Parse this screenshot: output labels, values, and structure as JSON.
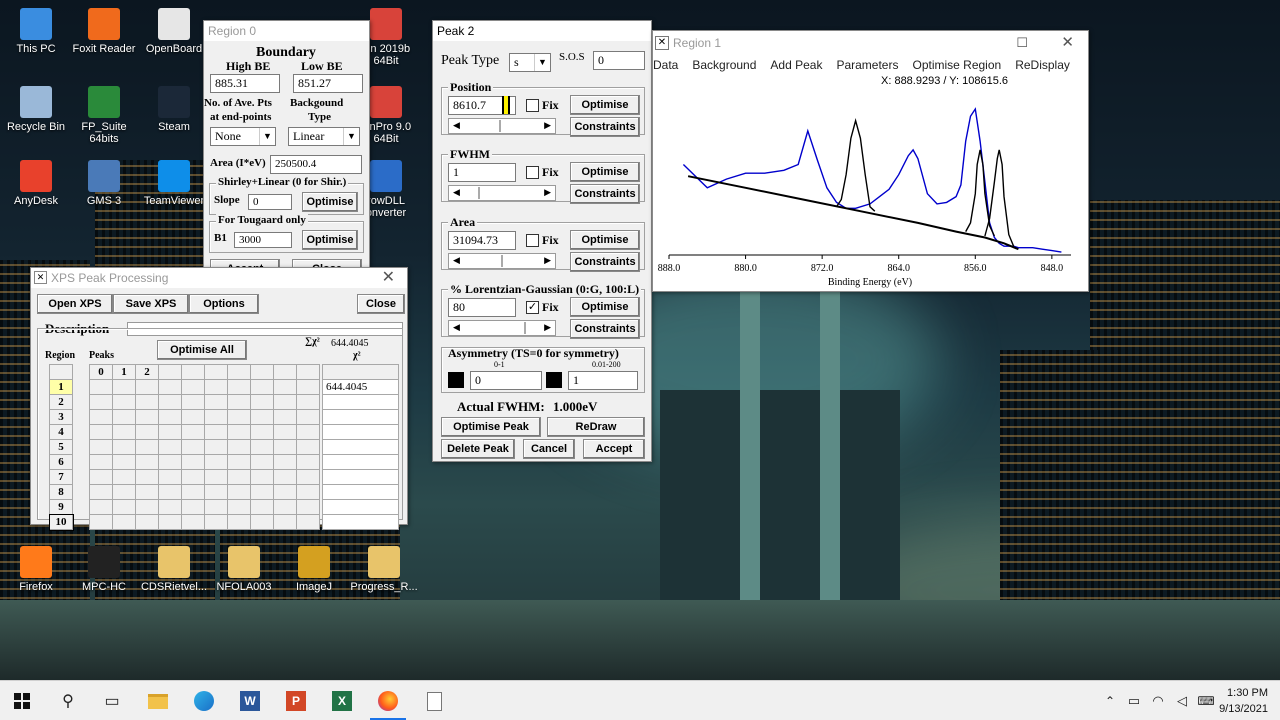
{
  "desktop_icons": [
    {
      "label": "This PC",
      "color": "#3a8de0"
    },
    {
      "label": "Foxit Reader",
      "color": "#f06a1c"
    },
    {
      "label": "OpenBoard",
      "color": "#e6e6e6"
    },
    {
      "label": "Recycle Bin",
      "color": "#9ab8d8"
    },
    {
      "label": "FP_Suite\n64bits",
      "color": "#2a8a3a"
    },
    {
      "label": "Steam",
      "color": "#1b2838"
    },
    {
      "label": "AnyDesk",
      "color": "#e8412c"
    },
    {
      "label": "GMS 3",
      "color": "#4a7ab8"
    },
    {
      "label": "TeamViewer",
      "color": "#0e8ee9"
    },
    {
      "label": "Firefox",
      "color": "#ff7a1a"
    },
    {
      "label": "MPC-HC",
      "color": "#222222"
    },
    {
      "label": "CDSRietvel...",
      "color": "#e8c46a"
    },
    {
      "label": "NFOLA003",
      "color": "#e8c46a"
    },
    {
      "label": "ImageJ",
      "color": "#d4a020"
    },
    {
      "label": "Progress_R...",
      "color": "#e8c46a"
    },
    {
      "label": "gin 2019b\n64Bit",
      "color": "#d8433a"
    },
    {
      "label": "ginPro 9.0\n64Bit",
      "color": "#d8433a"
    },
    {
      "label": "rowDLL\nonverter",
      "color": "#2b6cc8"
    }
  ],
  "region0": {
    "title": "Region 0",
    "heading": "Boundary",
    "high_be_label": "High BE",
    "low_be_label": "Low BE",
    "high_be": "885.31",
    "low_be": "851.27",
    "ave_pts_label_1": "No. of Ave. Pts",
    "ave_pts_label_2": "at end-points",
    "bg_type_label_1": "Backgound",
    "bg_type_label_2": "Type",
    "ave_pts_value": "None",
    "bg_type_value": "Linear",
    "area_label": "Area (I*eV)",
    "area_value": "250500.4",
    "shirley_title": "Shirley+Linear (0 for Shir.)",
    "slope_label": "Slope",
    "slope_value": "0",
    "tougaard_title": "For Tougaard only",
    "b1_label": "B1",
    "b1_value": "3000",
    "optimise_label": "Optimise",
    "accept_label": "Accept",
    "close_label": "Close"
  },
  "xps": {
    "title": "XPS Peak Processing",
    "open_label": "Open XPS",
    "save_label": "Save XPS",
    "options_label": "Options",
    "close_label": "Close",
    "description_label": "Description",
    "region_label": "Region",
    "peaks_label": "Peaks",
    "optimise_all_label": "Optimise All",
    "sum_chi_label": "∑χ²",
    "sum_chi_value": "644.4045",
    "chi_label": "χ²",
    "peak_cols": [
      "0",
      "1",
      "2",
      "",
      "",
      "",
      "",
      "",
      "",
      ""
    ],
    "regions": [
      "1",
      "2",
      "3",
      "4",
      "5",
      "6",
      "7",
      "8",
      "9",
      "10"
    ],
    "chi_values": [
      "644.4045",
      "",
      "",
      "",
      "",
      "",
      "",
      "",
      "",
      ""
    ]
  },
  "peak2": {
    "title": "Peak 2",
    "peak_type_label": "Peak Type",
    "peak_type_value": "s",
    "sos_label": "S.O.S",
    "sos_value": "0",
    "position_label": "Position",
    "position_value": "8610.7",
    "fwhm_label": "FWHM",
    "fwhm_value": "1",
    "area_label": "Area",
    "area_value": "31094.73",
    "lg_label": "% Lorentzian-Gaussian (0:G, 100:L)",
    "lg_value": "80",
    "fix_label": "Fix",
    "optimise_label": "Optimise",
    "constraints_label": "Constraints",
    "asym_label": "Asymmetry (TS=0 for symmetry)",
    "asym_range1": "0-1",
    "asym_range2": "0.01-200",
    "asym_value1": "0",
    "asym_value2": "1",
    "actual_fwhm_label": "Actual FWHM:",
    "actual_fwhm_value": "1.000eV",
    "optimise_peak_label": "Optimise Peak",
    "redraw_label": "ReDraw",
    "delete_label": "Delete Peak",
    "cancel_label": "Cancel",
    "accept_label": "Accept",
    "position_fixed": false,
    "fwhm_fixed": false,
    "area_fixed": false,
    "lg_fixed": true,
    "position_slider": 0.48,
    "fwhm_slider": 0.2,
    "area_slider": 0.5,
    "lg_slider": 0.8
  },
  "region1": {
    "title": "Region 1",
    "menu": [
      "Data",
      "Background",
      "Add Peak",
      "Parameters",
      "Optimise Region",
      "ReDisplay"
    ],
    "coord_readout": "X: 888.9293 / Y: 108615.6"
  },
  "chart_data": {
    "type": "line",
    "xlabel": "Binding Energy (eV)",
    "xlim": [
      888,
      846
    ],
    "x_ticks": [
      "888.0",
      "880.0",
      "872.0",
      "864.0",
      "856.0",
      "848.0"
    ],
    "tick_values": [
      888,
      880,
      872,
      864,
      856,
      848
    ],
    "grid": false,
    "series": [
      {
        "color": "#0000cc",
        "x": [
          886.5,
          884,
          882,
          880,
          878,
          876,
          874.5,
          873.5,
          872.5,
          871.5,
          870.5,
          869.5,
          868.5,
          867,
          866,
          865,
          864,
          863,
          862.5,
          862,
          861,
          860,
          859,
          858,
          857.5,
          857,
          856.5,
          856,
          855.5,
          855,
          854.5,
          854,
          853.5,
          853,
          852.5,
          852,
          851.5,
          851,
          850,
          849,
          848,
          847
        ],
        "y": [
          0.62,
          0.46,
          0.52,
          0.56,
          0.56,
          0.58,
          0.62,
          0.85,
          0.65,
          0.46,
          0.36,
          0.32,
          0.32,
          0.35,
          0.4,
          0.45,
          0.55,
          0.68,
          0.72,
          0.66,
          0.42,
          0.35,
          0.36,
          0.4,
          0.48,
          0.78,
          0.95,
          1.0,
          0.78,
          0.5,
          0.22,
          0.12,
          0.08,
          0.06,
          0.06,
          0.06,
          0.05,
          0.05,
          0.05,
          0.04,
          0.03,
          0.02
        ]
      },
      {
        "color": "#000000",
        "x": [
          886,
          880,
          874,
          868,
          862,
          858,
          855,
          853,
          851.5
        ],
        "y": [
          0.54,
          0.46,
          0.38,
          0.3,
          0.22,
          0.16,
          0.12,
          0.08,
          0.04
        ]
      },
      {
        "color": "#000000",
        "x": [
          870.5,
          870,
          869.5,
          869,
          868.5,
          868,
          867.5,
          867,
          866.5
        ],
        "y": [
          0.33,
          0.38,
          0.55,
          0.8,
          0.92,
          0.8,
          0.55,
          0.33,
          0.3
        ]
      },
      {
        "color": "#000000",
        "x": [
          857,
          856.5,
          856,
          855.8,
          855.5,
          855.2,
          855,
          854.5,
          854
        ],
        "y": [
          0.16,
          0.22,
          0.42,
          0.62,
          0.72,
          0.62,
          0.42,
          0.2,
          0.13
        ]
      },
      {
        "color": "#000000",
        "x": [
          855,
          854.5,
          854,
          853.7,
          853.5,
          853.2,
          853,
          852.5,
          852
        ],
        "y": [
          0.13,
          0.25,
          0.5,
          0.66,
          0.72,
          0.62,
          0.4,
          0.14,
          0.06
        ]
      }
    ]
  },
  "taskbar": {
    "time": "1:30 PM",
    "date": "9/13/2021"
  }
}
